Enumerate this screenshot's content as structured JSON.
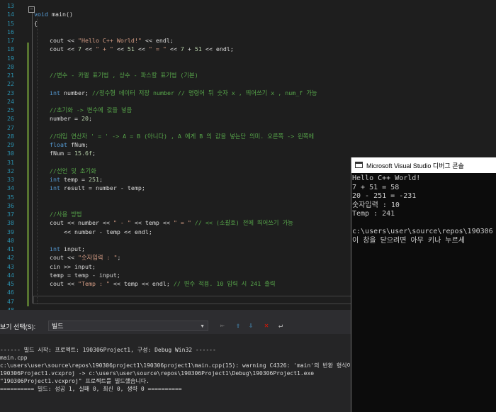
{
  "editor": {
    "lines": [
      {
        "n": "13",
        "parts": []
      },
      {
        "n": "14",
        "parts": [
          {
            "t": "void",
            "c": "kw"
          },
          {
            "t": " main()",
            "c": ""
          }
        ]
      },
      {
        "n": "15",
        "parts": [
          {
            "t": "{",
            "c": ""
          }
        ]
      },
      {
        "n": "16",
        "parts": []
      },
      {
        "n": "17",
        "parts": [
          {
            "t": "cout << ",
            "c": ""
          },
          {
            "t": "\"Hello C++ World!\"",
            "c": "str"
          },
          {
            "t": " << endl;",
            "c": ""
          }
        ]
      },
      {
        "n": "18",
        "parts": [
          {
            "t": "cout << ",
            "c": ""
          },
          {
            "t": "7",
            "c": "num"
          },
          {
            "t": " << ",
            "c": ""
          },
          {
            "t": "\" + \"",
            "c": "str"
          },
          {
            "t": " << ",
            "c": ""
          },
          {
            "t": "51",
            "c": "num"
          },
          {
            "t": " << ",
            "c": ""
          },
          {
            "t": "\" = \"",
            "c": "str"
          },
          {
            "t": " << ",
            "c": ""
          },
          {
            "t": "7",
            "c": "num"
          },
          {
            "t": " + ",
            "c": ""
          },
          {
            "t": "51",
            "c": "num"
          },
          {
            "t": " << endl;",
            "c": ""
          }
        ]
      },
      {
        "n": "19",
        "parts": []
      },
      {
        "n": "20",
        "parts": []
      },
      {
        "n": "21",
        "parts": [
          {
            "t": "//변수 - 카멜 표기법 , 상수 - 파스칼 표기법 (기본)",
            "c": "cmt"
          }
        ]
      },
      {
        "n": "22",
        "parts": []
      },
      {
        "n": "23",
        "parts": [
          {
            "t": "int",
            "c": "kw"
          },
          {
            "t": " number; ",
            "c": ""
          },
          {
            "t": "//정수형 데이터 저장 number // 명령어 뒤 숫자 x , 띄어쓰기 x , num_f 가능",
            "c": "cmt"
          }
        ]
      },
      {
        "n": "24",
        "parts": []
      },
      {
        "n": "25",
        "parts": [
          {
            "t": "//초기화 -> 변수에 값을 넣음",
            "c": "cmt"
          }
        ]
      },
      {
        "n": "26",
        "parts": [
          {
            "t": "number = ",
            "c": ""
          },
          {
            "t": "20",
            "c": "num"
          },
          {
            "t": ";",
            "c": ""
          }
        ]
      },
      {
        "n": "27",
        "parts": []
      },
      {
        "n": "28",
        "parts": [
          {
            "t": "//대입 연산자 ' = ' -> A = B (아니다) , A 에게 B 의 값을 넣는단 의미. 오른쪽 -> 왼쪽에",
            "c": "cmt"
          }
        ]
      },
      {
        "n": "29",
        "parts": [
          {
            "t": "float",
            "c": "kw"
          },
          {
            "t": " fNum;",
            "c": ""
          }
        ]
      },
      {
        "n": "30",
        "parts": [
          {
            "t": "fNum = ",
            "c": ""
          },
          {
            "t": "15.6f",
            "c": "num"
          },
          {
            "t": ";",
            "c": ""
          }
        ]
      },
      {
        "n": "31",
        "parts": []
      },
      {
        "n": "32",
        "parts": [
          {
            "t": "//선언 및 초기화",
            "c": "cmt"
          }
        ]
      },
      {
        "n": "33",
        "parts": [
          {
            "t": "int",
            "c": "kw"
          },
          {
            "t": " temp = ",
            "c": ""
          },
          {
            "t": "251",
            "c": "num"
          },
          {
            "t": ";",
            "c": ""
          }
        ]
      },
      {
        "n": "34",
        "parts": [
          {
            "t": "int",
            "c": "kw"
          },
          {
            "t": " result = number - temp;",
            "c": ""
          }
        ]
      },
      {
        "n": "35",
        "parts": []
      },
      {
        "n": "36",
        "parts": []
      },
      {
        "n": "37",
        "parts": [
          {
            "t": "//사용 방법",
            "c": "cmt"
          }
        ]
      },
      {
        "n": "38",
        "parts": [
          {
            "t": "cout << number << ",
            "c": ""
          },
          {
            "t": "\" - \"",
            "c": "str"
          },
          {
            "t": " << temp << ",
            "c": ""
          },
          {
            "t": "\" = \"",
            "c": "str"
          },
          {
            "t": " ",
            "c": ""
          },
          {
            "t": "// << (소괄호) 전에 띄어쓰기 가능",
            "c": "cmt"
          }
        ]
      },
      {
        "n": "39",
        "parts": [
          {
            "t": "    << number - temp << endl;",
            "c": ""
          }
        ]
      },
      {
        "n": "40",
        "parts": []
      },
      {
        "n": "41",
        "parts": [
          {
            "t": "int",
            "c": "kw"
          },
          {
            "t": " input;",
            "c": ""
          }
        ]
      },
      {
        "n": "42",
        "parts": [
          {
            "t": "cout << ",
            "c": ""
          },
          {
            "t": "\"숫자입력 : \"",
            "c": "str"
          },
          {
            "t": ";",
            "c": ""
          }
        ]
      },
      {
        "n": "43",
        "parts": [
          {
            "t": "cin >> input;",
            "c": ""
          }
        ]
      },
      {
        "n": "44",
        "parts": [
          {
            "t": "temp = temp - input;",
            "c": ""
          }
        ]
      },
      {
        "n": "45",
        "parts": [
          {
            "t": "cout << ",
            "c": ""
          },
          {
            "t": "\"Temp : \"",
            "c": "str"
          },
          {
            "t": " << temp << endl; ",
            "c": ""
          },
          {
            "t": "// 변수 적용. 10 입력 시 241 출력",
            "c": "cmt"
          }
        ]
      },
      {
        "n": "46",
        "parts": []
      },
      {
        "n": "47",
        "parts": []
      },
      {
        "n": "48",
        "parts": []
      }
    ]
  },
  "output": {
    "show_output_label": "보기 선택(S):",
    "source": "빌드",
    "lines": [
      "------ 빌드 시작: 프로젝트: 190306Project1, 구성: Debug Win32 ------",
      "main.cpp",
      "c:\\users\\user\\source\\repos\\190306project1\\190306project1\\main.cpp(15): warning C4326: 'main'의 반환 형식이",
      "190306Project1.vcxproj -> c:\\users\\user\\source\\repos\\190306Project1\\Debug\\190306Project1.exe",
      "\"190306Project1.vcxproj\" 프로젝트를 빌드했습니다.",
      "========== 빌드: 성공 1, 실패 0, 최신 0, 생략 0 =========="
    ]
  },
  "console": {
    "title": "Microsoft Visual Studio 디버그 콘솔",
    "lines": [
      "Hello C++ World!",
      "7 + 51 = 58",
      "20 - 251 = -231",
      "숫자입력 : 10",
      "Temp : 241",
      "",
      "c:\\users\\user\\source\\repos\\190306",
      "이 창을 닫으려면 아무 키나 누르세"
    ]
  },
  "icons": {
    "collapse": "collapse-minus-icon",
    "dropdown": "chevron-down-icon",
    "find_prev": "find-previous-icon",
    "goto_prev": "goto-previous-message-icon",
    "goto_next": "goto-next-message-icon",
    "clear_all": "clear-all-icon",
    "word_wrap": "word-wrap-icon",
    "console_app": "console-window-icon"
  },
  "colors": {
    "keyword": "#569cd6",
    "comment": "#57a64a",
    "string": "#d69d85",
    "line_number": "#2b91af",
    "change_bar": "#577430"
  }
}
